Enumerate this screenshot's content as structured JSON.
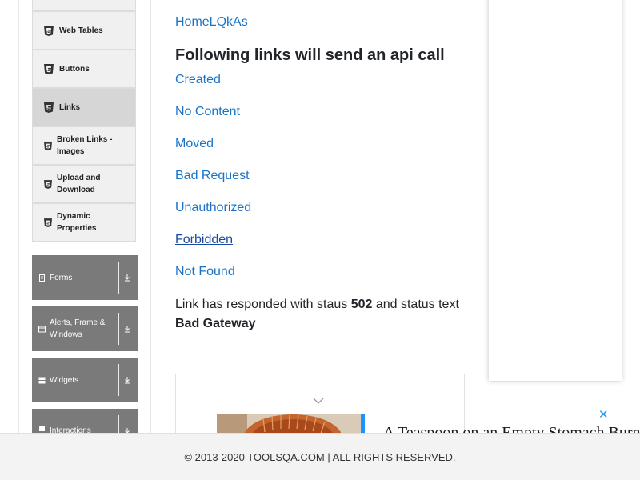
{
  "sidebar": {
    "sub_items": [
      {
        "label": "Web Tables",
        "icon": "html5-icon"
      },
      {
        "label": "Buttons",
        "icon": "html5-icon"
      },
      {
        "label": "Links",
        "icon": "html5-icon",
        "active": true
      },
      {
        "label_line1": "Broken Links -",
        "label_line2": "Images",
        "icon": "html5-icon"
      },
      {
        "label_line1": "Upload and",
        "label_line2": "Download",
        "icon": "html5-icon"
      },
      {
        "label_line1": "Dynamic",
        "label_line2": "Properties",
        "icon": "html5-icon"
      }
    ],
    "groups": [
      {
        "label": "Forms",
        "icon": "document-icon"
      },
      {
        "label_line1": "Alerts, Frame &",
        "label_line2": "Windows",
        "icon": "window-icon"
      },
      {
        "label": "Widgets",
        "icon": "grid-icon"
      },
      {
        "label": "Interactions",
        "icon": "move-icon"
      }
    ]
  },
  "main": {
    "top_link": "HomeLQkAs",
    "heading": "Following links will send an api call",
    "api_links": [
      {
        "label": "Created"
      },
      {
        "label": "No Content"
      },
      {
        "label": "Moved"
      },
      {
        "label": "Bad Request"
      },
      {
        "label": "Unauthorized"
      },
      {
        "label": "Forbidden",
        "visited": true
      },
      {
        "label": "Not Found"
      }
    ],
    "response": {
      "prefix": "Link has responded with staus ",
      "status_code": "502",
      "middle": " and status text",
      "status_text": "Bad Gateway"
    }
  },
  "ad": {
    "close_glyph": "✕",
    "headline": "A Teaspoon on an Empty Stomach Burns"
  },
  "footer": {
    "text": "© 2013-2020 TOOLSQA.COM | ALL RIGHTS RESERVED."
  },
  "colors": {
    "link": "#1a73c8",
    "sidebar_group_bg": "#7a7a7a",
    "footer_bg": "#f3f3f3"
  }
}
